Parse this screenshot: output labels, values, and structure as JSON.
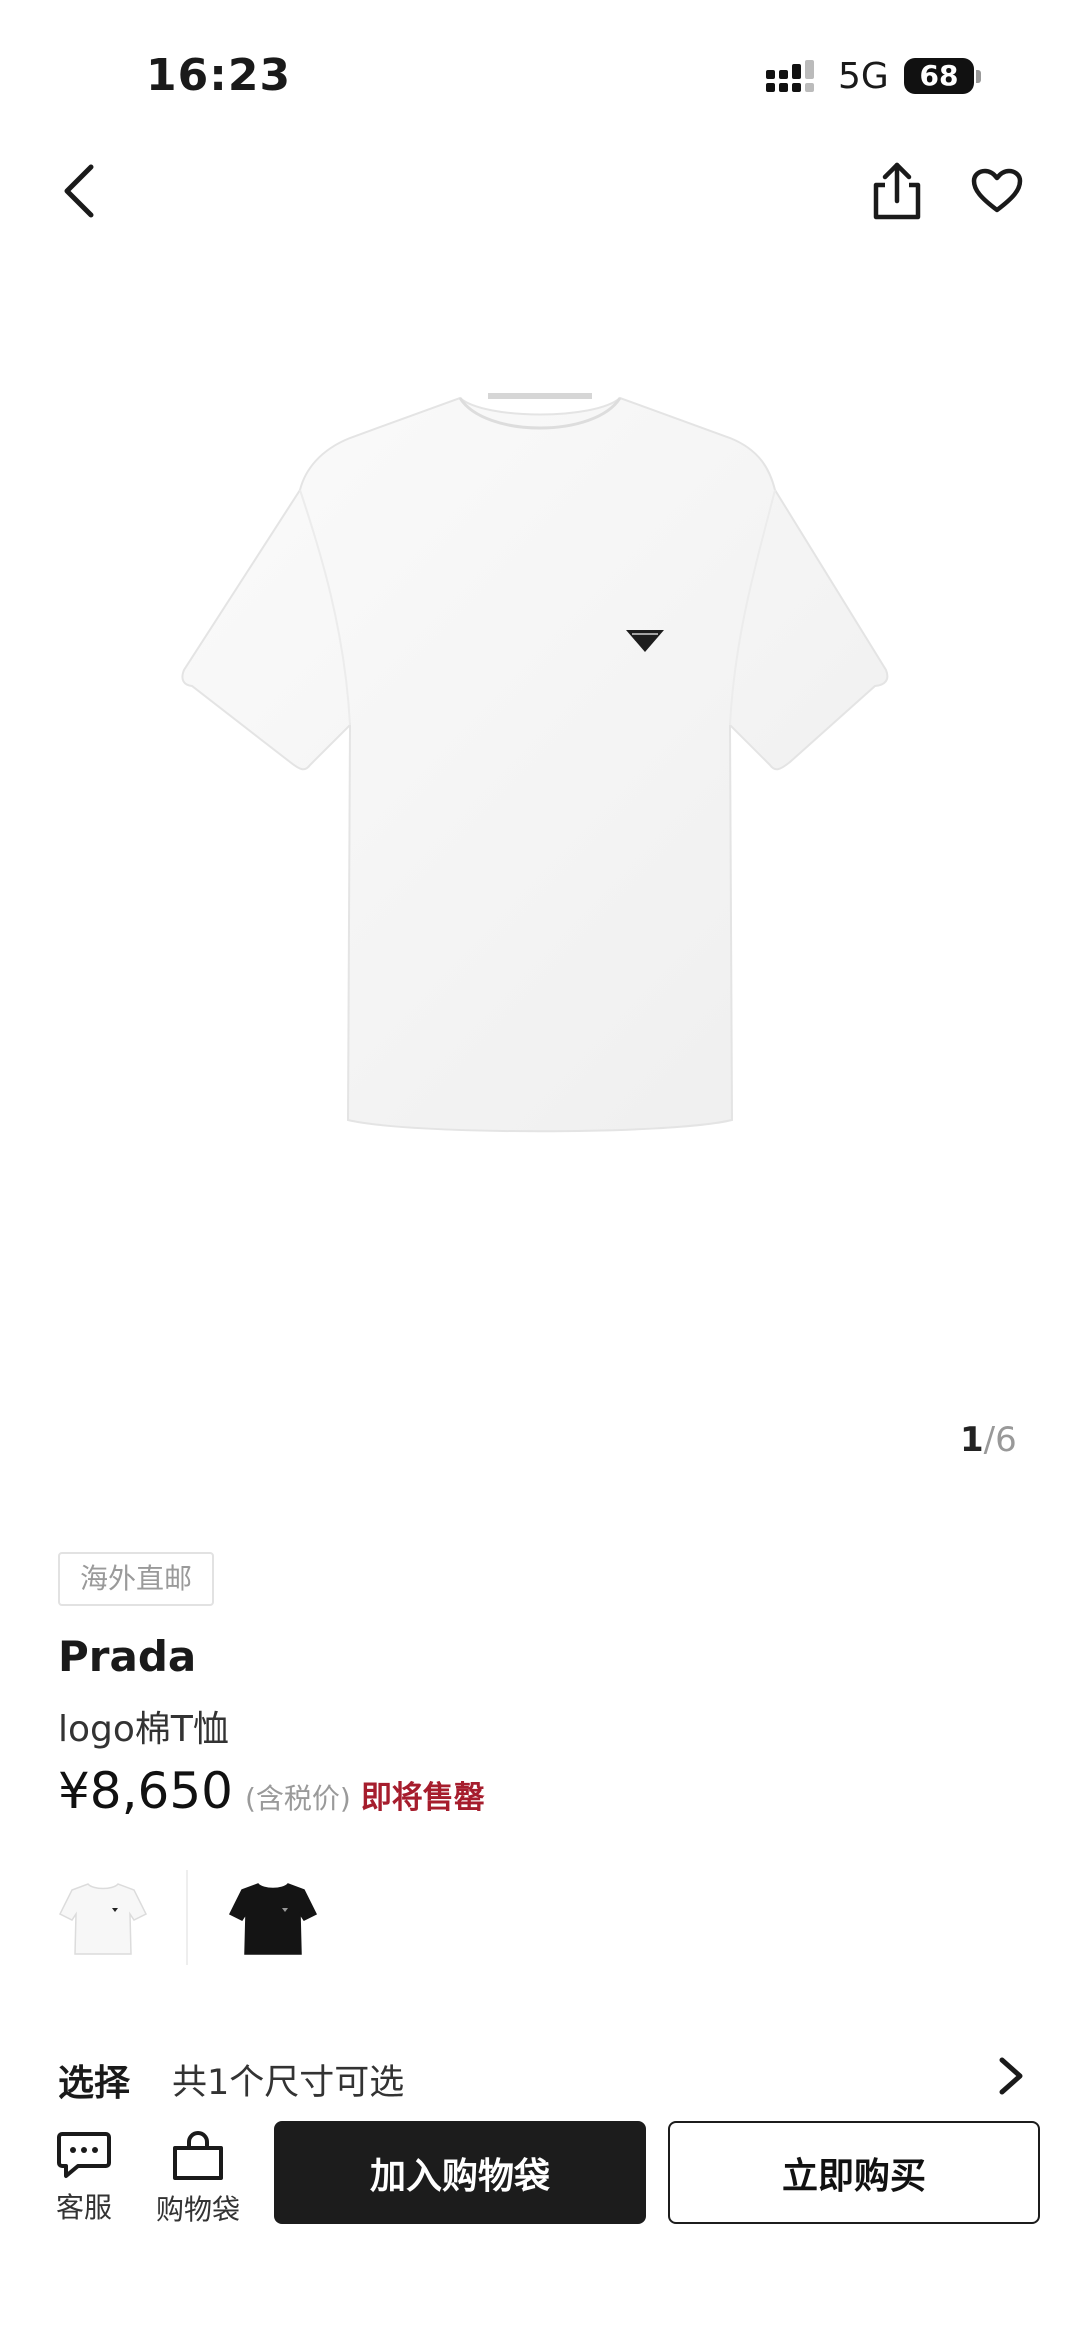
{
  "status_bar": {
    "time": "16:23",
    "network": "5G",
    "battery": "68"
  },
  "gallery": {
    "current": "1",
    "separator": "/",
    "total": "6"
  },
  "product": {
    "tag": "海外直邮",
    "brand": "Prada",
    "name": "logo棉T恤",
    "price": "¥8,650",
    "tax_note": "(含税价)",
    "stock_note": "即将售罄"
  },
  "variants": [
    {
      "color": "white",
      "selected": true
    },
    {
      "color": "black",
      "selected": false
    }
  ],
  "size_select": {
    "label": "选择",
    "value": "共1个尺寸可选"
  },
  "bottom_bar": {
    "service_label": "客服",
    "bag_label": "购物袋",
    "add_to_bag": "加入购物袋",
    "buy_now": "立即购买"
  },
  "colors": {
    "accent_red": "#a61d2d",
    "button_dark": "#1c1c1c"
  }
}
